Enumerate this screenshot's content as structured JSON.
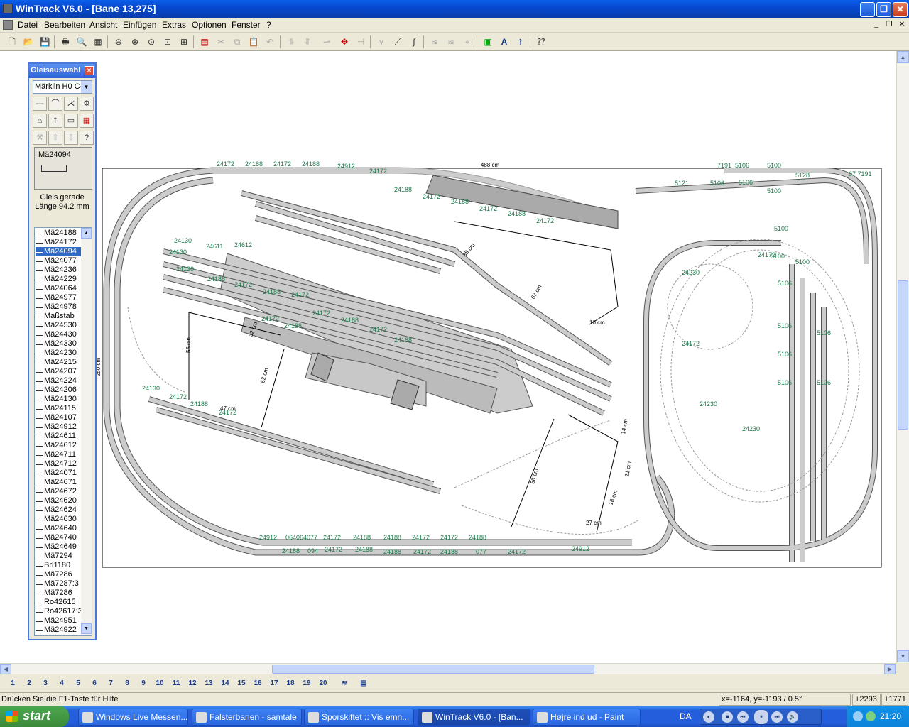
{
  "window": {
    "title": "WinTrack  V6.0 - [Bane 13,275]"
  },
  "menu": [
    "Datei",
    "Bearbeiten",
    "Ansicht",
    "Einfügen",
    "Extras",
    "Optionen",
    "Fenster",
    "?"
  ],
  "palette": {
    "title": "Gleisauswahl",
    "catalog": "Märklin H0 C-",
    "preview_name": "Mä24094",
    "desc_line1": "Gleis gerade",
    "desc_line2": "Länge 94.2 mm",
    "items": [
      "Mä24188",
      "Mä24172",
      "Mä24094",
      "Mä24077",
      "Mä24236",
      "Mä24229",
      "Mä24064",
      "Mä24977",
      "Mä24978",
      "Maßstab",
      "Mä24530",
      "Mä24430",
      "Mä24330",
      "Mä24230",
      "Mä24215",
      "Mä24207",
      "Mä24224",
      "Mä24206",
      "Mä24130",
      "Mä24115",
      "Mä24107",
      "Mä24912",
      "Mä24611",
      "Mä24612",
      "Mä24711",
      "Mä24712",
      "Mä24071",
      "Mä24671",
      "Mä24672",
      "Mä24620",
      "Mä24624",
      "Mä24630",
      "Mä24640",
      "Mä24740",
      "Mä24649",
      "Mä7294",
      "Brl1180",
      "Mä7286",
      "Mä7287:3",
      "Mä7286",
      "Ro42615",
      "Ro42617:3",
      "Mä24951",
      "Mä24922"
    ],
    "selected_index": 2
  },
  "drawing": {
    "board_width_label": "488 cm",
    "board_height_label": "250 cm",
    "labels": [
      {
        "t": "24172"
      },
      {
        "t": "24188"
      },
      {
        "t": "24172"
      },
      {
        "t": "24188"
      },
      {
        "t": "24912"
      },
      {
        "t": "24172"
      },
      {
        "t": "24188"
      },
      {
        "t": "24172"
      },
      {
        "t": "24188"
      },
      {
        "t": "24172"
      },
      {
        "t": "24188"
      },
      {
        "t": "24172"
      },
      {
        "t": "7191"
      },
      {
        "t": "5106"
      },
      {
        "t": "5100"
      },
      {
        "t": "07 7191"
      },
      {
        "t": "5121"
      },
      {
        "t": "5106"
      },
      {
        "t": "5100"
      },
      {
        "t": "5128"
      },
      {
        "t": "5106"
      },
      {
        "t": "24130"
      },
      {
        "t": "24611"
      },
      {
        "t": "24612"
      },
      {
        "t": "24130"
      },
      {
        "t": "24130"
      },
      {
        "t": "24188"
      },
      {
        "t": "24172"
      },
      {
        "t": "24188"
      },
      {
        "t": "24172"
      },
      {
        "t": "24172"
      },
      {
        "t": "24188"
      },
      {
        "t": "24172"
      },
      {
        "t": "24188"
      },
      {
        "t": "24172"
      },
      {
        "t": "24188"
      },
      {
        "t": "24912"
      },
      {
        "t": "064064077"
      },
      {
        "t": "24172"
      },
      {
        "t": "24188"
      },
      {
        "t": "24188"
      },
      {
        "t": "24172"
      },
      {
        "t": "24172"
      },
      {
        "t": "24188"
      },
      {
        "t": "24912"
      },
      {
        "t": "24188"
      },
      {
        "t": "094"
      },
      {
        "t": "24172"
      },
      {
        "t": "24188"
      },
      {
        "t": "24188"
      },
      {
        "t": "24172"
      },
      {
        "t": "24188"
      },
      {
        "t": "077"
      },
      {
        "t": "24172"
      },
      {
        "t": "5106"
      },
      {
        "t": "5106"
      },
      {
        "t": "5106"
      },
      {
        "t": "5106"
      },
      {
        "t": "5100"
      },
      {
        "t": "5100"
      },
      {
        "t": "24230"
      },
      {
        "t": "24230"
      },
      {
        "t": "24230"
      },
      {
        "t": "24172"
      },
      {
        "t": "24172"
      },
      {
        "t": "5100"
      },
      {
        "t": "5106"
      },
      {
        "t": "5106"
      },
      {
        "t": "24130"
      },
      {
        "t": "24172"
      },
      {
        "t": "24188"
      },
      {
        "t": "24172"
      },
      {
        "t": "55 cm"
      },
      {
        "t": "52 cm"
      },
      {
        "t": "47 cm"
      },
      {
        "t": "32 cm"
      },
      {
        "t": "10 cm"
      },
      {
        "t": "35 cm"
      },
      {
        "t": "67 cm"
      },
      {
        "t": "27 cm"
      },
      {
        "t": "18 cm"
      },
      {
        "t": "21 cm"
      },
      {
        "t": "14 cm"
      },
      {
        "t": "58 cm"
      }
    ]
  },
  "layers": [
    "1",
    "2",
    "3",
    "4",
    "5",
    "6",
    "7",
    "8",
    "9",
    "10",
    "11",
    "12",
    "13",
    "14",
    "15",
    "16",
    "17",
    "18",
    "19",
    "20"
  ],
  "status": {
    "help": "Drücken Sie die  F1-Taste für Hilfe",
    "coords": "x=-1164, y=-1193 / 0.5°",
    "off1": "+2293",
    "off2": "+1771"
  },
  "taskbar": {
    "start": "start",
    "tasks": [
      "Windows Live Messen...",
      "Falsterbanen - samtale",
      "Sporskiftet :: Vis emn...",
      "WinTrack  V6.0 - [Ban...",
      "Højre ind ud - Paint"
    ],
    "active_index": 3,
    "lang": "DA",
    "clock": "21:20"
  }
}
